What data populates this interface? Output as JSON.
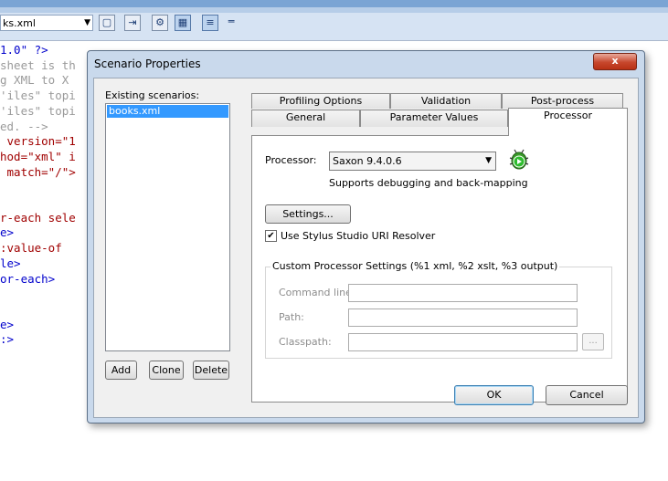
{
  "app": {
    "file_combo_value": "ks.xml",
    "code_lines": [
      {
        "text": "1.0\" ?>",
        "cls": "c-blue"
      },
      {
        "text": "sheet is th",
        "cls": "c-gray"
      },
      {
        "text": "g XML to X",
        "cls": "c-gray"
      },
      {
        "text": "'iles\" topi",
        "cls": "c-gray"
      },
      {
        "text": "'iles\" topi",
        "cls": "c-gray"
      },
      {
        "text": "ed. -->",
        "cls": "c-gray"
      },
      {
        "text": " version=\"1",
        "cls": "c-red"
      },
      {
        "text": "hod=\"xml\" i",
        "cls": "c-red"
      },
      {
        "text": " match=\"/\">",
        "cls": "c-red"
      },
      {
        "text": "",
        "cls": "c-blue"
      },
      {
        "text": "",
        "cls": "c-blue"
      },
      {
        "text": "r-each sele",
        "cls": "c-red"
      },
      {
        "text": "e>",
        "cls": "c-blue"
      },
      {
        "text": ":value-of ",
        "cls": "c-red"
      },
      {
        "text": "le>",
        "cls": "c-blue"
      },
      {
        "text": "or-each>",
        "cls": "c-blue"
      },
      {
        "text": "",
        "cls": "c-blue"
      },
      {
        "text": "",
        "cls": "c-blue"
      },
      {
        "text": "e>",
        "cls": "c-blue"
      },
      {
        "text": ":>",
        "cls": "c-blue"
      }
    ]
  },
  "dialog": {
    "title": "Scenario Properties",
    "close_label": "x",
    "existing_scenarios_label": "Existing scenarios:",
    "scenarios": [
      "books.xml"
    ],
    "add_label": "Add",
    "clone_label": "Clone",
    "delete_label": "Delete",
    "tabs_row_back": [
      "Profiling Options",
      "Validation",
      "Post-process"
    ],
    "tabs_row_front": [
      "General",
      "Parameter Values",
      "Processor"
    ],
    "selected_tab": "Processor",
    "processor": {
      "label": "Processor:",
      "value": "Saxon 9.4.0.6",
      "support_text": "Supports debugging and back-mapping",
      "settings_label": "Settings...",
      "uri_resolver_label": "Use Stylus Studio URI Resolver",
      "uri_resolver_checked": true,
      "group_title": "Custom Processor Settings (%1 xml, %2 xslt, %3 output)",
      "command_line_label": "Command line:",
      "path_label": "Path:",
      "classpath_label": "Classpath:",
      "browse_label": "..."
    },
    "ok_label": "OK",
    "cancel_label": "Cancel"
  }
}
